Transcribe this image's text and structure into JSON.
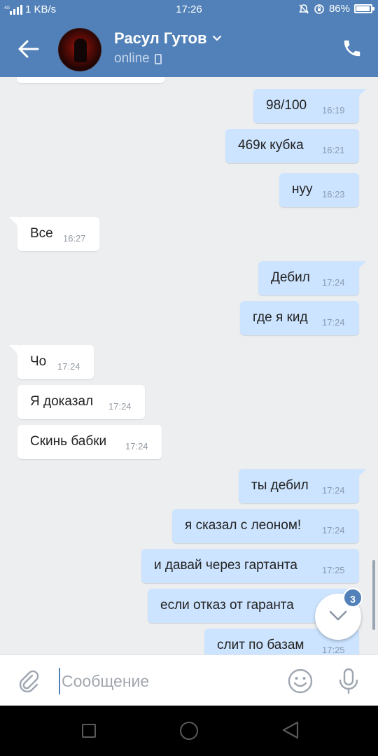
{
  "status_bar": {
    "network_speed": "1 KB/s",
    "time": "17:26",
    "battery": "86%"
  },
  "header": {
    "contact_name": "Расул Гутов",
    "contact_status": "online"
  },
  "top_partial_message": "",
  "messages": [
    {
      "direction": "out",
      "text": "98/100",
      "time": "16:19"
    },
    {
      "direction": "out",
      "text": "469к кубка",
      "time": "16:21"
    },
    {
      "direction": "out",
      "text": "нуу",
      "time": "16:23"
    },
    {
      "direction": "in",
      "text": "Все",
      "time": "16:27"
    },
    {
      "direction": "out",
      "text": "Дебил",
      "time": "17:24"
    },
    {
      "direction": "out",
      "text": "где я кид",
      "time": "17:24"
    },
    {
      "direction": "in",
      "text": "Чо",
      "time": "17:24"
    },
    {
      "direction": "in",
      "text": "Я доказал",
      "time": "17:24"
    },
    {
      "direction": "in",
      "text": "Скинь бабки",
      "time": "17:24"
    },
    {
      "direction": "out",
      "text": "ты дебил",
      "time": "17:24"
    },
    {
      "direction": "out",
      "text": "я сказал с леоном!",
      "time": "17:24"
    },
    {
      "direction": "out",
      "text": "и давай через гартанта",
      "time": "17:25"
    },
    {
      "direction": "out",
      "text": "если отказ  от гаранта",
      "time": ""
    },
    {
      "direction": "out",
      "text": "слит по базам",
      "time": "17:25"
    }
  ],
  "scroll_down": {
    "badge_count": "3"
  },
  "composer": {
    "placeholder": "Сообщение"
  },
  "colors": {
    "accent": "#5181b8",
    "outgoing_bubble": "#cce4ff",
    "incoming_bubble": "#ffffff",
    "chat_background": "#edeef0"
  }
}
